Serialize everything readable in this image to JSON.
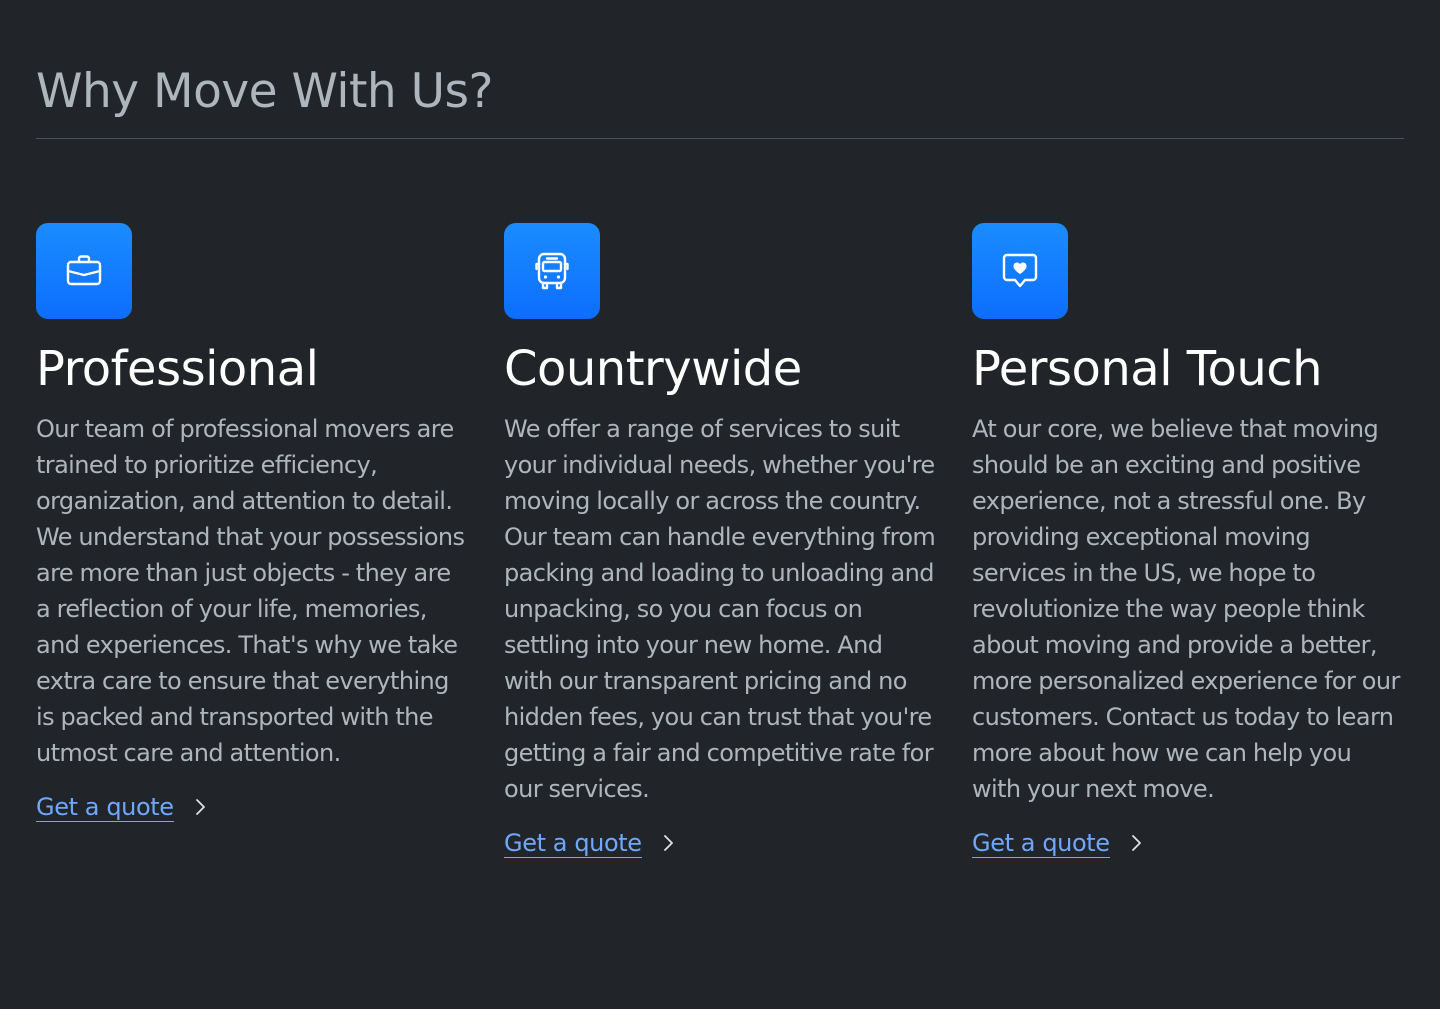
{
  "section": {
    "title": "Why Move With Us?"
  },
  "features": [
    {
      "icon": "briefcase-icon",
      "title": "Professional",
      "text": "Our team of professional movers are trained to prioritize efficiency, organization, and attention to detail. We understand that your possessions are more than just objects - they are a reflection of your life, memories, and experiences. That's why we take extra care to ensure that everything is packed and transported with the utmost care and attention.",
      "link_label": "Get a quote"
    },
    {
      "icon": "bus-icon",
      "title": "Countrywide",
      "text": "We offer a range of services to suit your individual needs, whether you're moving locally or across the country. Our team can handle everything from packing and loading to unloading and unpacking, so you can focus on settling into your new home. And with our transparent pricing and no hidden fees, you can trust that you're getting a fair and competitive rate for our services.",
      "link_label": "Get a quote"
    },
    {
      "icon": "chat-heart-icon",
      "title": "Personal Touch",
      "text": "At our core, we believe that moving should be an exciting and positive experience, not a stressful one. By providing exceptional moving services in the US, we hope to revolutionize the way people think about moving and provide a better, more personalized experience for our customers. Contact us today to learn more about how we can help you with your next move.",
      "link_label": "Get a quote"
    }
  ],
  "colors": {
    "background": "#212529",
    "accent": "#0d6efd",
    "link": "#6ea8fe",
    "muted_text": "#adb5bd",
    "heading": "#ffffff"
  }
}
